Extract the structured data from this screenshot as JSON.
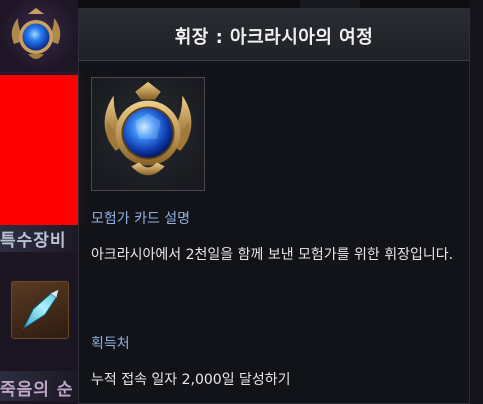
{
  "tooltip": {
    "title": "휘장 : 아크라시아의 여정",
    "description_heading": "모험가 카드 설명",
    "description_text": "아크라시아에서 2천일을 함께 보낸 모험가를 위한 휘장입니다.",
    "acquisition_heading": "획득처",
    "acquisition_text": "누적 접속 일자 2,000일 달성하기"
  },
  "background": {
    "section_special_equipment": "특수장비",
    "section_death": "죽음의 순"
  },
  "icons": {
    "emblem": "winged-blue-gem-emblem-icon",
    "item": "blue-crystal-shard-icon"
  },
  "colors": {
    "heading_accent": "#8fb2e0",
    "redaction": "#ff0000"
  }
}
